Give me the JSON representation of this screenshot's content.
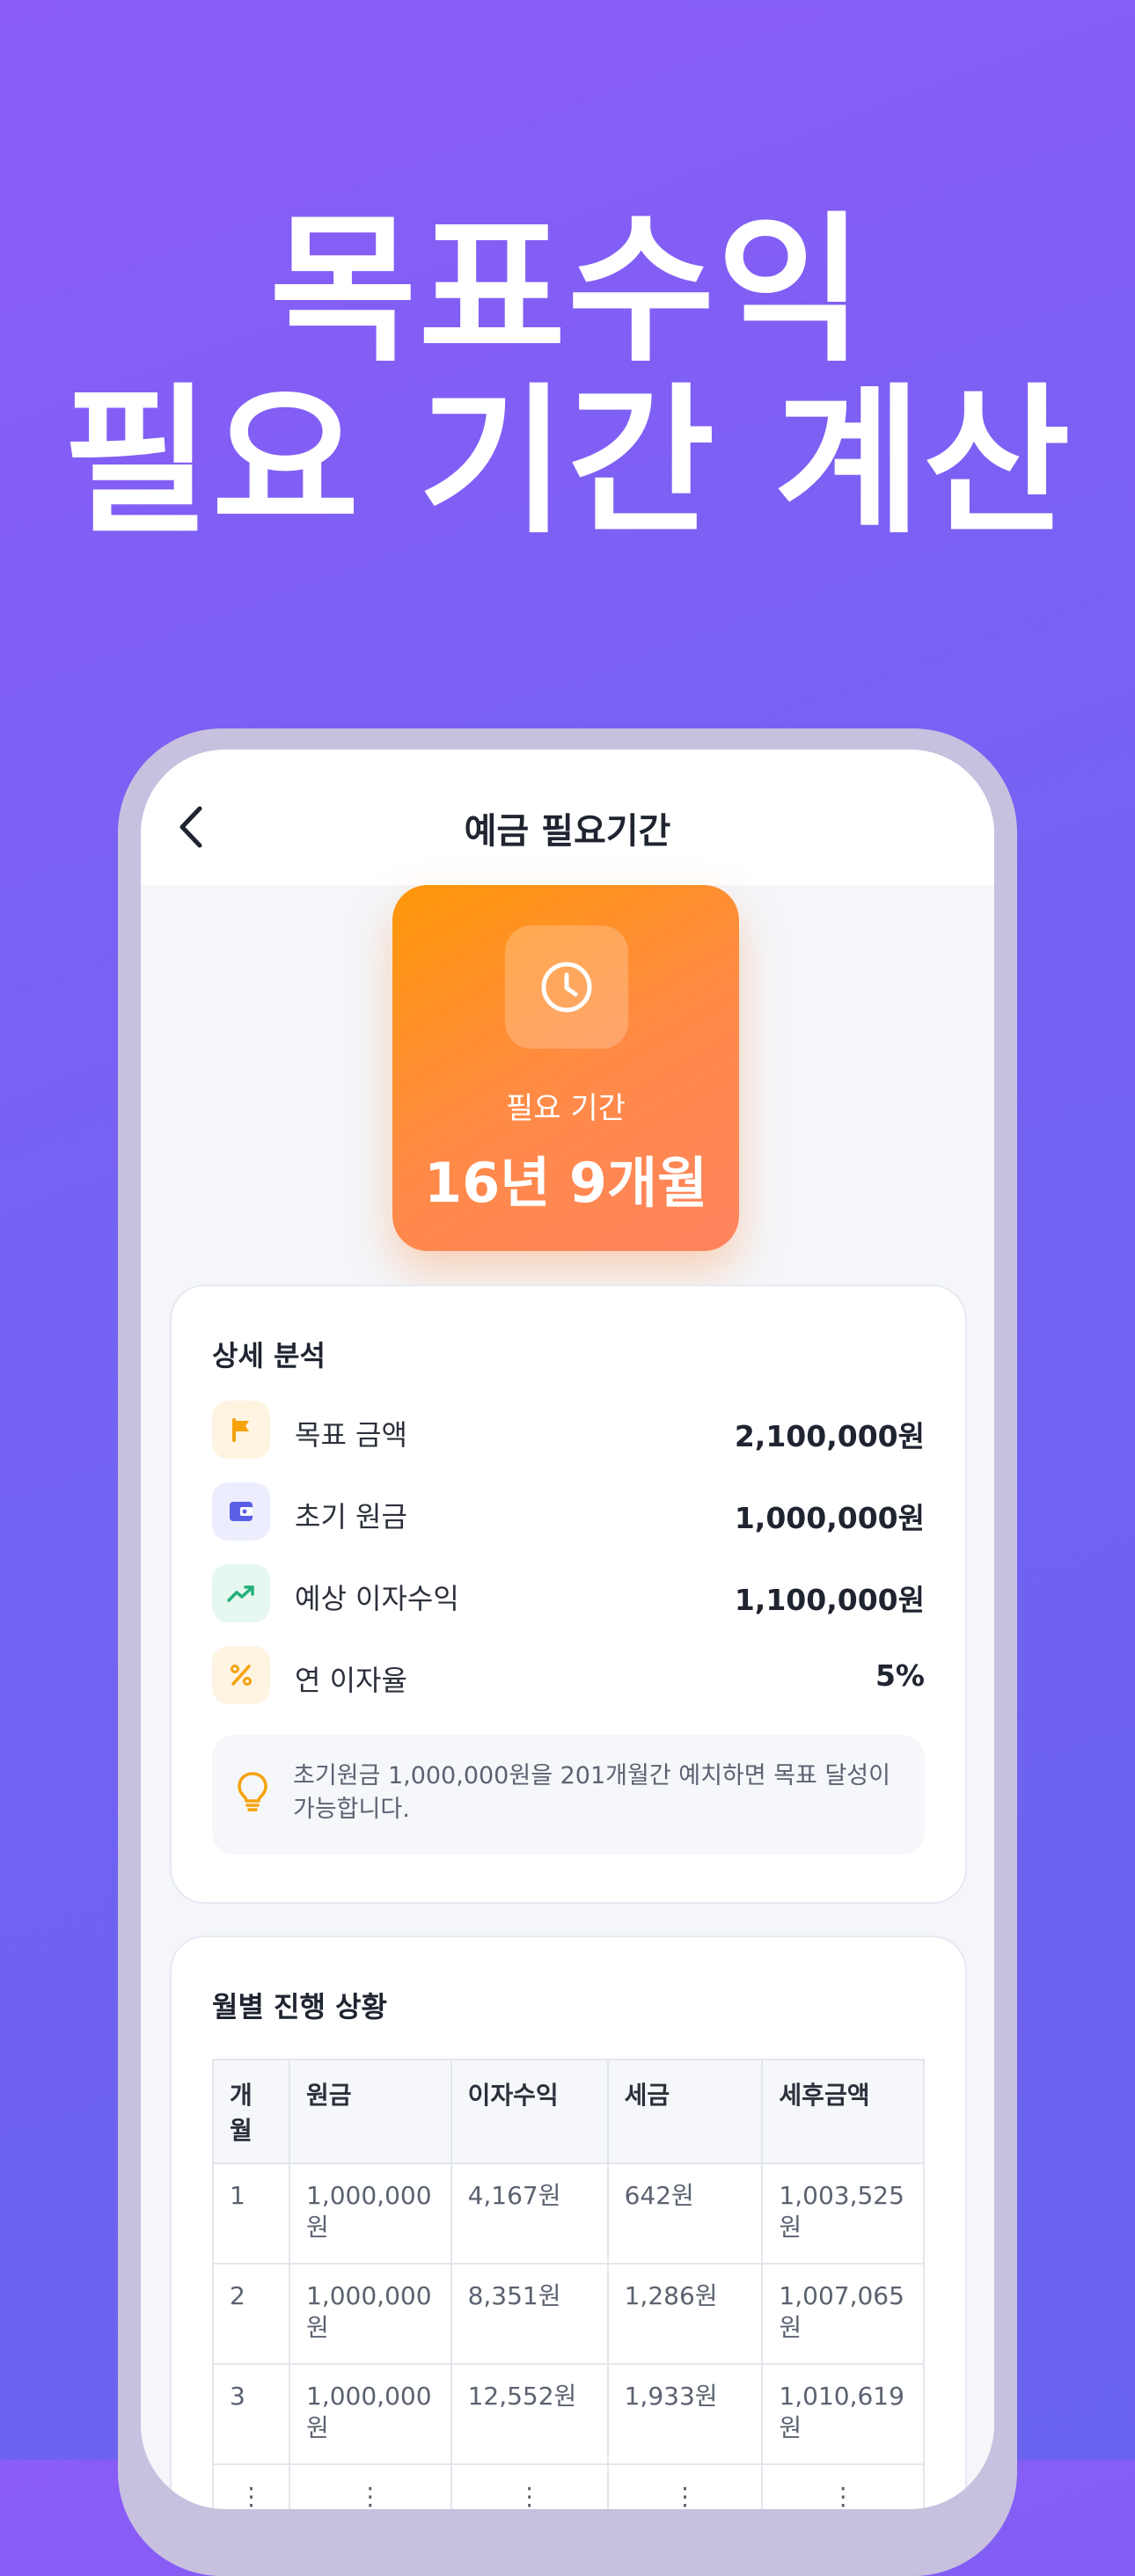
{
  "promo": {
    "line1": "목표수익",
    "line2": "필요 기간 계산"
  },
  "nav": {
    "title": "예금 필요기간",
    "back_icon": "chevron-left-icon"
  },
  "hero": {
    "icon": "clock-icon",
    "label": "필요 기간",
    "value": "16년 9개월",
    "colors": {
      "from": "#ff9708",
      "to": "#ff8460"
    }
  },
  "analysis": {
    "title": "상세 분석",
    "rows": [
      {
        "icon": "flag-icon",
        "label": "목표 금액",
        "value": "2,100,000원",
        "icon_color": "#f5a20b",
        "icon_bg": "#fff3e2"
      },
      {
        "icon": "wallet-icon",
        "label": "초기 원금",
        "value": "1,000,000원",
        "icon_color": "#5b5fe6",
        "icon_bg": "#ecedfd"
      },
      {
        "icon": "trending-up-icon",
        "label": "예상 이자수익",
        "value": "1,100,000원",
        "icon_color": "#22b07a",
        "icon_bg": "#e5f7ef"
      },
      {
        "icon": "percent-icon",
        "label": "연 이자율",
        "value": "5%",
        "icon_color": "#f5a20b",
        "icon_bg": "#fff3e2"
      }
    ],
    "tip": {
      "icon": "lightbulb-icon",
      "text": "초기원금 1,000,000원을 201개월간 예치하면 목표 달성이 가능합니다."
    }
  },
  "monthly": {
    "title": "월별 진행 상황",
    "headers": [
      "개월",
      "원금",
      "이자수익",
      "세금",
      "세후금액"
    ],
    "rows": [
      [
        "1",
        "1,000,000원",
        "4,167원",
        "642원",
        "1,003,525원"
      ],
      [
        "2",
        "1,000,000원",
        "8,351원",
        "1,286원",
        "1,007,065원"
      ],
      [
        "3",
        "1,000,000원",
        "12,552원",
        "1,933원",
        "1,010,619원"
      ],
      [
        "⋮",
        "⋮",
        "⋮",
        "⋮",
        "⋮"
      ]
    ]
  }
}
